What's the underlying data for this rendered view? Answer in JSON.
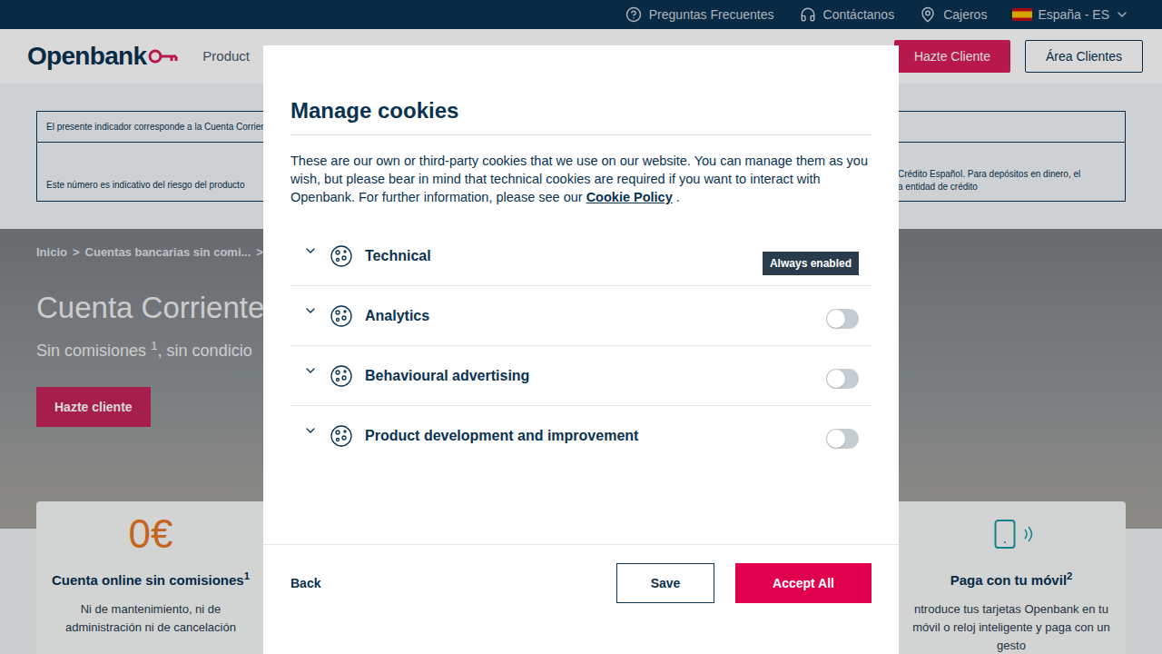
{
  "topbar": {
    "links": [
      "Preguntas Frecuentes",
      "Contáctanos",
      "Cajeros"
    ],
    "locale": "España - ES"
  },
  "header": {
    "logo": "Openbank",
    "nav": "Product",
    "buttons": [
      "Hazte Cliente",
      "Área Clientes"
    ]
  },
  "indicator": {
    "row1": "El presente indicador corresponde a la Cuenta Corrien",
    "row2_left": "Este número es indicativo del riesgo del producto",
    "row2_right": [
      "Crédito Español. Para depósitos en dinero, el",
      "a entidad de crédito"
    ]
  },
  "hero": {
    "breadcrumb": [
      "Inicio",
      "Cuentas bancarias sin comi..."
    ],
    "separator": ">",
    "title": "Cuenta Corriente",
    "subtitle": "Sin comisiones",
    "subtitle_sup": "1",
    "subtitle_rest": ", sin condicio",
    "button": "Hazte cliente"
  },
  "cards": [
    {
      "kind": "amount",
      "big": "0€",
      "title": "Cuenta online sin comisiones",
      "sup": "1",
      "lines": [
        "Ni de mantenimiento, ni de",
        "administración ni de cancelación"
      ]
    },
    {
      "kind": "phone",
      "big": "",
      "title": "Paga con tu móvil",
      "sup": "2",
      "lines": [
        "ntroduce tus tarjetas Openbank en tu",
        "móvil o reloj inteligente y paga con un",
        "gesto"
      ]
    }
  ],
  "modal": {
    "title": "Manage cookies",
    "intro": "These are our own or third-party cookies that we use on our website. You can manage them as you wish, but please bear in mind that technical cookies are required if you want to interact with Openbank. For further information, please see our ",
    "link": "Cookie Policy",
    "after": " .",
    "categories": [
      {
        "name": "Technical",
        "kind": "badge",
        "badge": "Always enabled",
        "on": true,
        "expanded": false
      },
      {
        "name": "Analytics",
        "kind": "toggle",
        "badge": "",
        "on": false,
        "expanded": false
      },
      {
        "name": "Behavioural advertising",
        "kind": "toggle",
        "badge": "",
        "on": false,
        "expanded": false
      },
      {
        "name": "Product development and improvement",
        "kind": "toggle",
        "badge": "",
        "on": false,
        "expanded": false
      }
    ],
    "back": "Back",
    "save": "Save",
    "accept": "Accept All"
  }
}
